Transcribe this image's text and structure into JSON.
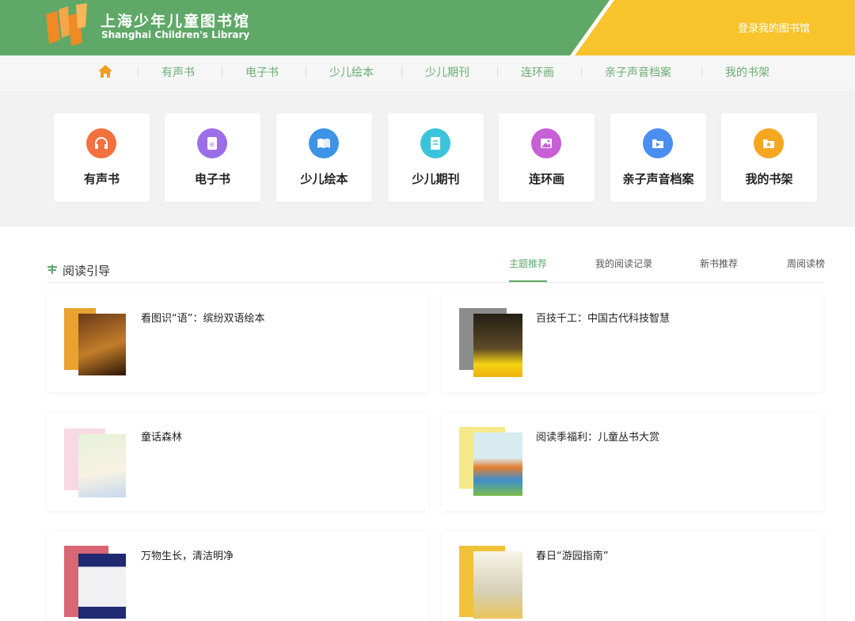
{
  "header": {
    "logo_cn": "上海少年儿童图书馆",
    "logo_en": "Shanghai Children's Library",
    "login_label": "登录我的图书馆",
    "colors": {
      "green": "#5fa867",
      "yellow": "#f8c42b",
      "logo_orange": "#f08a24"
    }
  },
  "nav": {
    "home_icon": "home-icon",
    "items": [
      "有声书",
      "电子书",
      "少儿绘本",
      "少儿期刊",
      "连环画",
      "亲子声音档案",
      "我的书架"
    ]
  },
  "categories": [
    {
      "label": "有声书",
      "icon": "headphones-icon",
      "color": "#f2713f"
    },
    {
      "label": "电子书",
      "icon": "ebook-icon",
      "color": "#9b6ee8"
    },
    {
      "label": "少儿绘本",
      "icon": "picture-book-icon",
      "color": "#3d93e6"
    },
    {
      "label": "少儿期刊",
      "icon": "journal-icon",
      "color": "#3cc3dc"
    },
    {
      "label": "连环画",
      "icon": "comic-icon",
      "color": "#c85fd6"
    },
    {
      "label": "亲子声音档案",
      "icon": "voice-archive-icon",
      "color": "#4a8ff0"
    },
    {
      "label": "我的书架",
      "icon": "bookshelf-icon",
      "color": "#f7a622"
    }
  ],
  "reading_guide": {
    "title": "阅读引导",
    "tabs": [
      "主题推荐",
      "我的阅读记录",
      "新书推荐",
      "周阅读榜"
    ],
    "active_tab": "主题推荐",
    "items": [
      {
        "title": "看图识“语”：缤纷双语绘本"
      },
      {
        "title": "百技千工：中国古代科技智慧"
      },
      {
        "title": "童话森林"
      },
      {
        "title": "阅读季福利：儿童丛书大赏"
      },
      {
        "title": "万物生长，清洁明净"
      },
      {
        "title": "春日“游园指南”"
      }
    ]
  }
}
